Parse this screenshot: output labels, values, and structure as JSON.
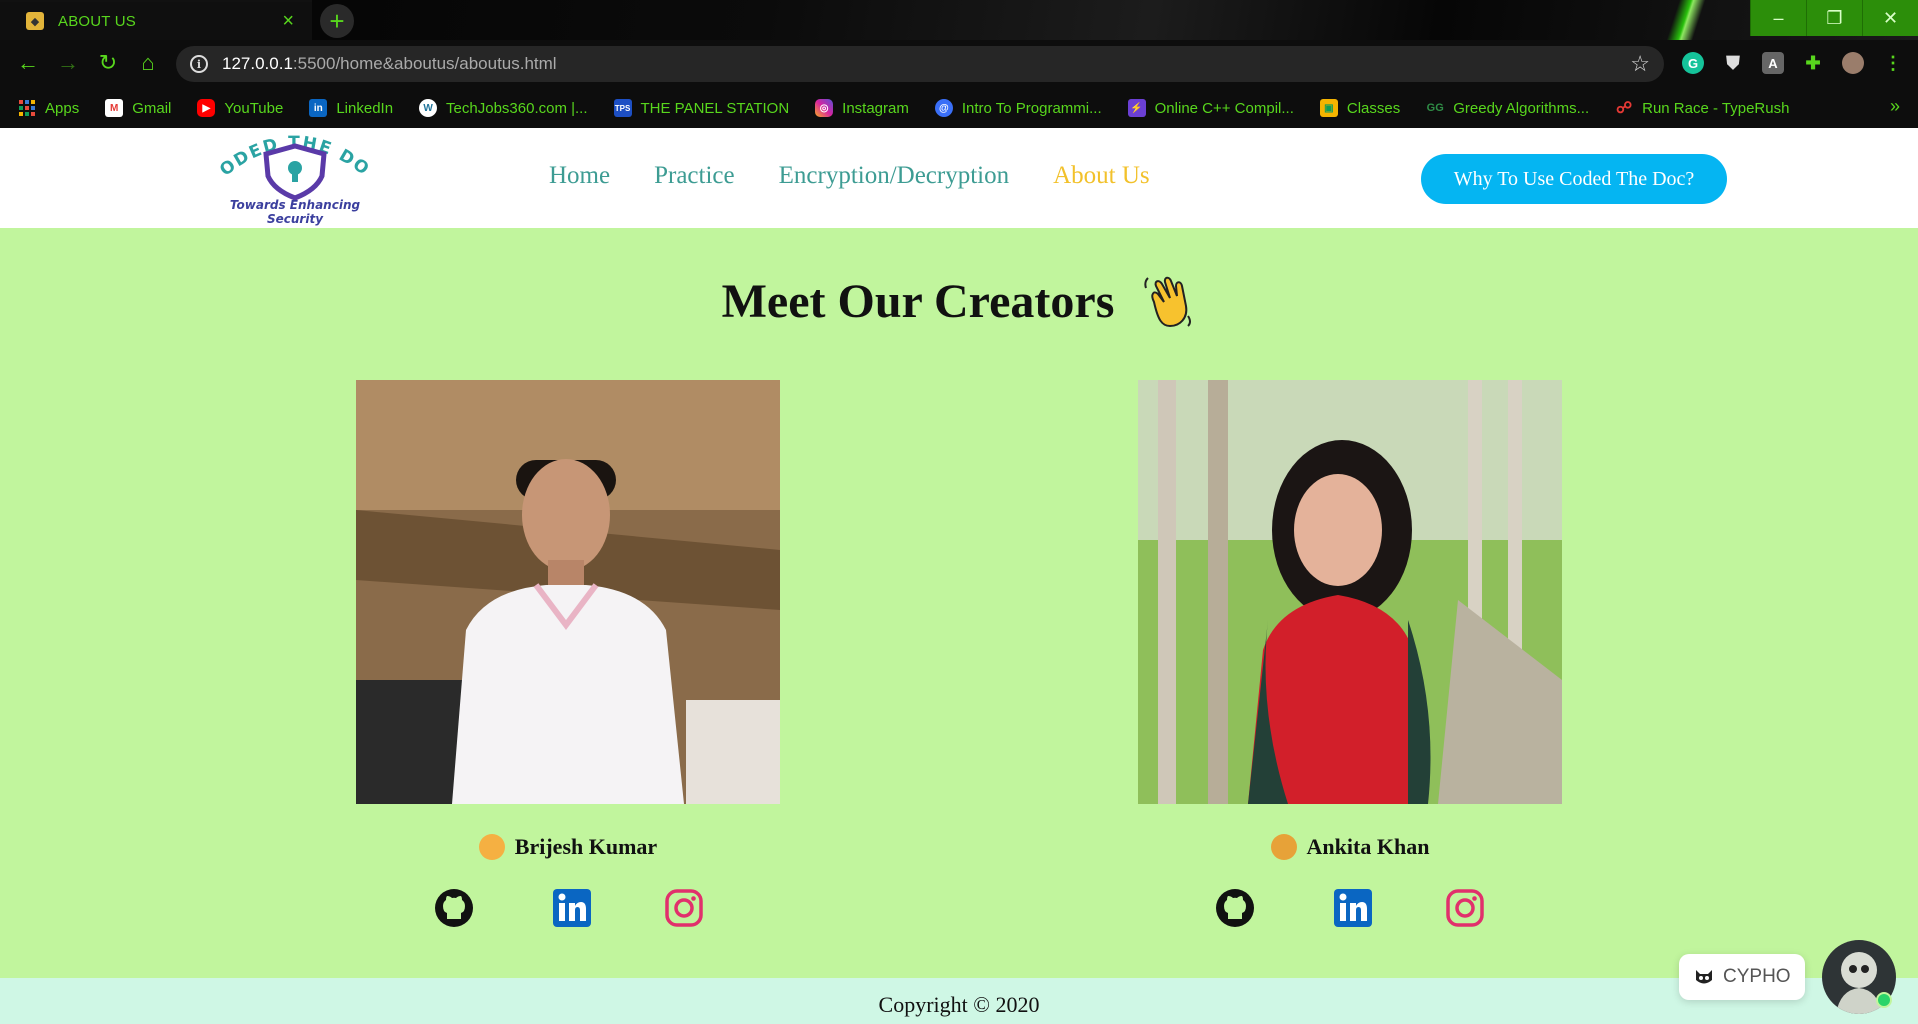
{
  "browser": {
    "tab": {
      "title": "ABOUT US"
    },
    "url": {
      "host": "127.0.0.1",
      "path": ":5500/home&aboutus/aboutus.html"
    },
    "bookmarks": [
      {
        "label": "Apps",
        "icon": "apps-grid-icon",
        "color": "#e84b3c"
      },
      {
        "label": "Gmail",
        "icon": "gmail-icon",
        "color": "#e53935"
      },
      {
        "label": "YouTube",
        "icon": "youtube-icon",
        "color": "#ff0000"
      },
      {
        "label": "LinkedIn",
        "icon": "linkedin-icon",
        "color": "#0a66c2"
      },
      {
        "label": "TechJobs360.com |...",
        "icon": "wordpress-icon",
        "color": "#ffffff"
      },
      {
        "label": "THE PANEL STATION",
        "icon": "tps-icon",
        "color": "#1d4fc4"
      },
      {
        "label": "Instagram",
        "icon": "instagram-icon",
        "color": "#d6249f"
      },
      {
        "label": "Intro To Programmi...",
        "icon": "globe-icon",
        "color": "#3a6ff7"
      },
      {
        "label": "Online C++ Compil...",
        "icon": "bolt-icon",
        "color": "#6b3fd4"
      },
      {
        "label": "Classes",
        "icon": "classroom-icon",
        "color": "#f4b400"
      },
      {
        "label": "Greedy Algorithms...",
        "icon": "gg-icon",
        "color": "#2f8d46"
      },
      {
        "label": "Run Race - TypeRush",
        "icon": "typerush-icon",
        "color": "#e53935"
      }
    ]
  },
  "site": {
    "logo_tagline": "Towards Enhancing Security",
    "logo_title": "CODED THE DOC",
    "nav": [
      {
        "label": "Home"
      },
      {
        "label": "Practice"
      },
      {
        "label": "Encryption/Decryption"
      },
      {
        "label": "About Us",
        "active": true
      }
    ],
    "cta_label": "Why To Use Coded The Doc?",
    "heading": "Meet Our Creators",
    "creators": [
      {
        "name": "Brijesh Kumar",
        "socials": [
          "github-icon",
          "linkedin-icon",
          "instagram-icon"
        ]
      },
      {
        "name": "Ankita Khan",
        "socials": [
          "github-icon",
          "linkedin-icon",
          "instagram-icon"
        ]
      }
    ],
    "footer": "Copyright © 2020",
    "chat_widget_label": "CYPHO"
  },
  "colors": {
    "page_bg": "#c1f59d",
    "nav_link": "#3d9c93",
    "nav_active": "#f2c12b",
    "cta_bg": "#05b5f2",
    "footer_bg": "#cff7e5",
    "browser_accent": "#58d61d"
  }
}
